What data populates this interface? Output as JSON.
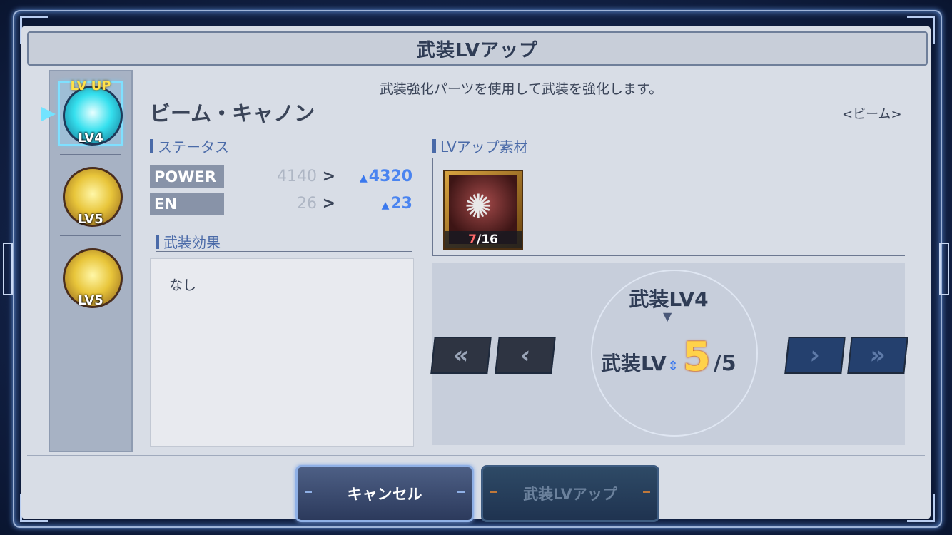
{
  "title": "武装LVアップ",
  "description": "武装強化パーツを使用して武装を強化します。",
  "weapon": {
    "name": "ビーム・キャノン",
    "type": "<ビーム>"
  },
  "sidebar": {
    "lvup_label": "LV UP",
    "items": [
      {
        "level": "LV4",
        "selected": true
      },
      {
        "level": "LV5",
        "selected": false
      },
      {
        "level": "LV5",
        "selected": false
      }
    ]
  },
  "status": {
    "heading": "ステータス",
    "power": {
      "label": "POWER",
      "current": "4140",
      "new": "4320"
    },
    "en": {
      "label": "EN",
      "current": "26",
      "new": "23"
    }
  },
  "effect": {
    "heading": "武装効果",
    "text": "なし"
  },
  "materials": {
    "heading": "LVアップ素材",
    "have": "7",
    "need": "/16"
  },
  "level": {
    "current": "武装LV4",
    "new_label": "武装LV",
    "new_value": "5",
    "max": "/5"
  },
  "buttons": {
    "cancel": "キャンセル",
    "confirm": "武装LVアップ"
  },
  "colors": {
    "accent_blue": "#4a84f0",
    "level_yellow": "#ffd24a",
    "panel": "#d8dde6"
  }
}
